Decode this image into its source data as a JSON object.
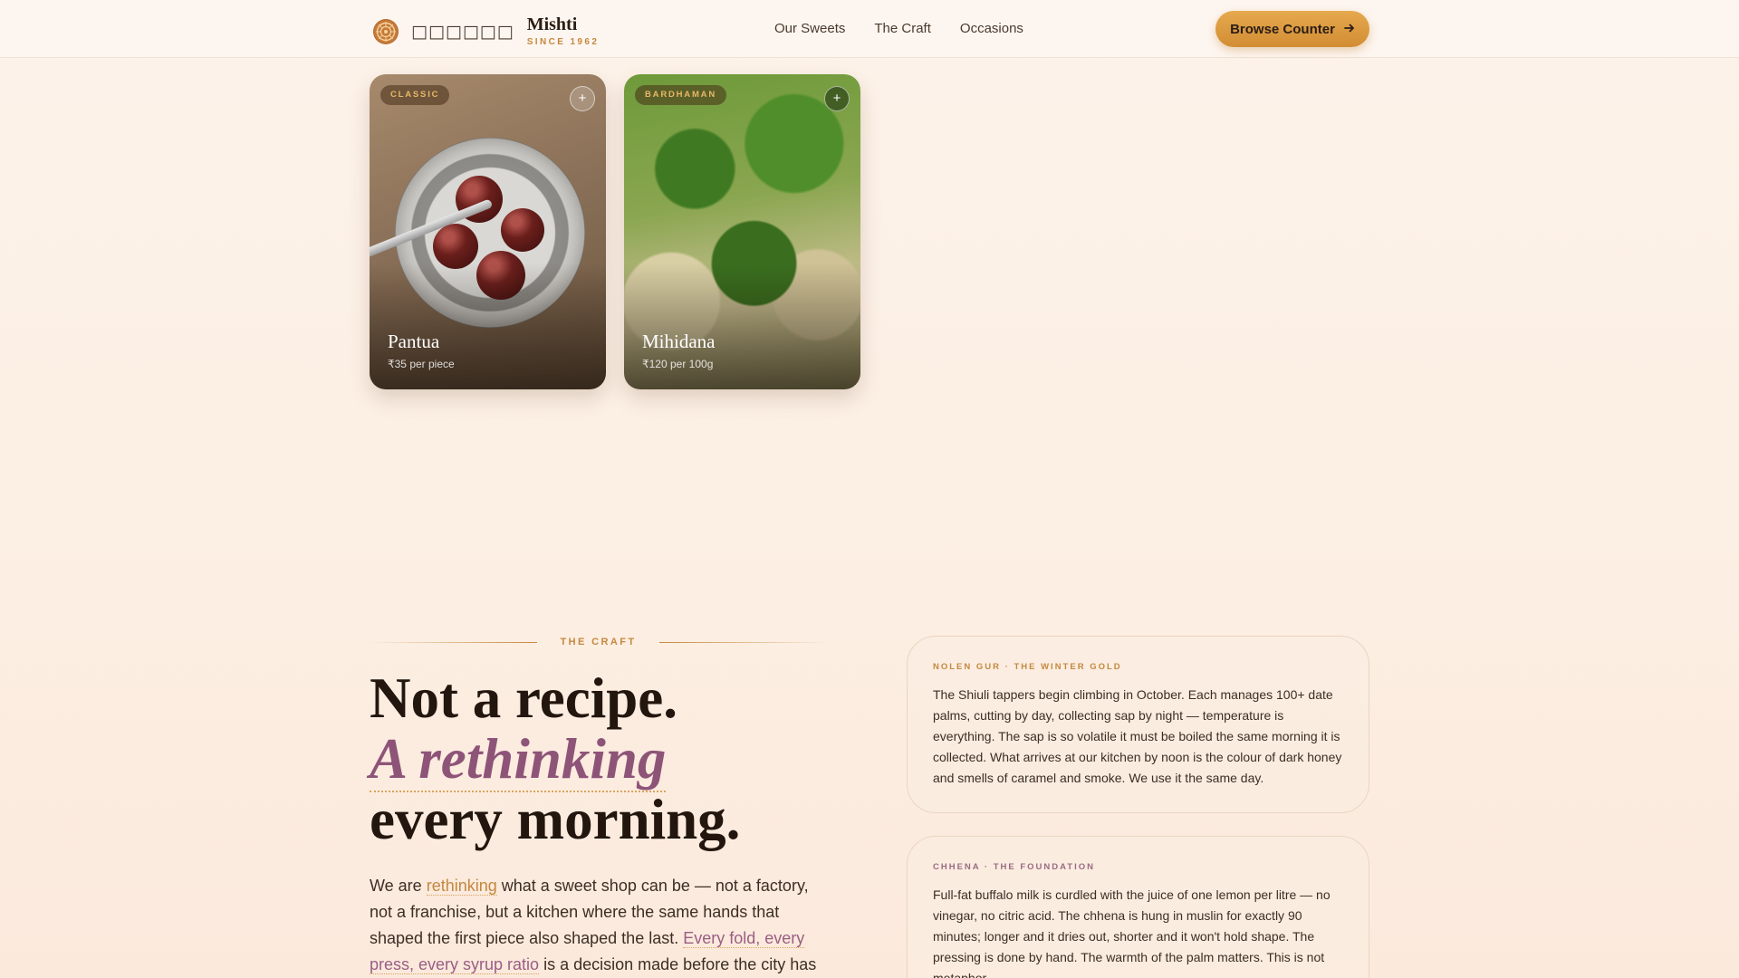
{
  "brand": {
    "glyphs": "□□□□□□",
    "name": "Mishti",
    "since": "SINCE 1962"
  },
  "nav": {
    "items": [
      "Our Sweets",
      "The Craft",
      "Occasions"
    ]
  },
  "cta": {
    "label": "Browse Counter",
    "icon": "arrow-right-icon"
  },
  "products": [
    {
      "tag": "CLASSIC",
      "name": "Pantua",
      "price": "₹35 per piece"
    },
    {
      "tag": "BARDHAMAN",
      "name": "Mihidana",
      "price": "₹120 per 100g"
    }
  ],
  "craft": {
    "eyebrow": "THE CRAFT",
    "headline_1": "Not a recipe.",
    "headline_2": "A rethinking",
    "headline_3": "every morning.",
    "body_1": "We are ",
    "body_hl_1": "rethinking",
    "body_2": " what a sweet shop can be — not a factory, not a franchise, but a kitchen where the same hands that shaped the first piece also shaped the last. ",
    "body_hl_2": "Every fold, every press, every syrup ratio",
    "body_3": " is a decision made before the city has"
  },
  "info_cards": [
    {
      "title": "NOLEN GUR · THE WINTER GOLD",
      "text": "The Shiuli tappers begin climbing in October. Each manages 100+ date palms, cutting by day, collecting sap by night — temperature is everything. The sap is so volatile it must be boiled the same morning it is collected. What arrives at our kitchen by noon is the colour of dark honey and smells of caramel and smoke. We use it the same day."
    },
    {
      "title": "CHHENA · THE FOUNDATION",
      "text": "Full-fat buffalo milk is curdled with the juice of one lemon per litre — no vinegar, no citric acid. The chhena is hung in muslin for exactly 90 minutes; longer and it dries out, shorter and it won't hold shape. The pressing is done by hand. The warmth of the palm matters. This is not metaphor."
    }
  ],
  "colors": {
    "accent_gold": "#c4883f",
    "accent_plum": "#8e5478",
    "cta_bg": "#dc9b41",
    "background": "#fdf3ea"
  }
}
